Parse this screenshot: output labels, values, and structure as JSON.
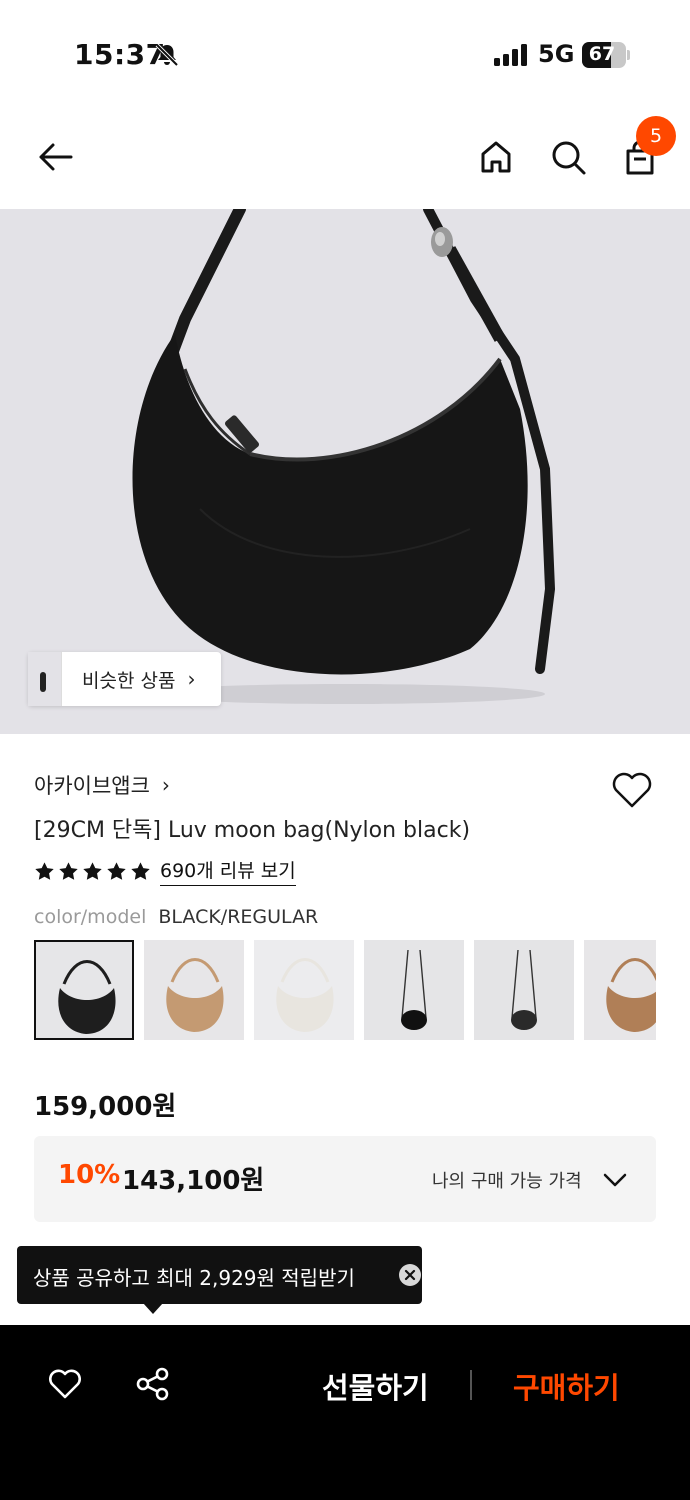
{
  "status_bar": {
    "time": "15:37",
    "network": "5G",
    "battery_percent": "67",
    "battery_level": 0.67,
    "icons": [
      "bell-muted-icon",
      "signal-icon",
      "battery-icon"
    ]
  },
  "nav": {
    "icons": [
      "back-arrow-icon",
      "home-icon",
      "search-icon",
      "cart-icon"
    ],
    "cart_count": "5"
  },
  "hero": {
    "similar_label": "비슷한 상품",
    "similar_chevron": "›"
  },
  "product": {
    "brand": "아카이브앱크",
    "brand_chevron": "›",
    "title": "[29CM 단독] Luv moon bag(Nylon black)",
    "rating_stars": 5,
    "review_link": "690개 리뷰 보기",
    "option_label": "color/model",
    "option_value": "BLACK/REGULAR",
    "swatches": [
      {
        "name": "black",
        "color": "#1e1e1e",
        "bg": "#e6e6e8"
      },
      {
        "name": "beige",
        "color": "#c49a72",
        "bg": "#e7e6e8"
      },
      {
        "name": "ivory",
        "color": "#e8e5df",
        "bg": "#ececee"
      },
      {
        "name": "black-mini",
        "color": "#111111",
        "bg": "#e5e5e7"
      },
      {
        "name": "black-mini-2",
        "color": "#2a2a2a",
        "bg": "#e4e4e6"
      },
      {
        "name": "tan",
        "color": "#b07f57",
        "bg": "#e7e6e8"
      }
    ],
    "selected_swatch": 0
  },
  "price": {
    "original": "159,000원",
    "discount_percent": "10%",
    "discount_price": "143,100원",
    "my_price_label": "나의 구매 가능 가격"
  },
  "tooltip": {
    "text": "상품 공유하고 최대 2,929원 적립받기",
    "close_icon": "close-icon"
  },
  "bottom_bar": {
    "gift_label": "선물하기",
    "buy_label": "구매하기",
    "icons": [
      "heart-icon",
      "share-icon"
    ]
  },
  "colors": {
    "accent": "#ff4800",
    "text": "#111111",
    "muted": "#9a9a9a",
    "hero_bg": "#e3e2e7",
    "price_box_bg": "#f4f4f4",
    "bottom_bar_bg": "#000000"
  }
}
